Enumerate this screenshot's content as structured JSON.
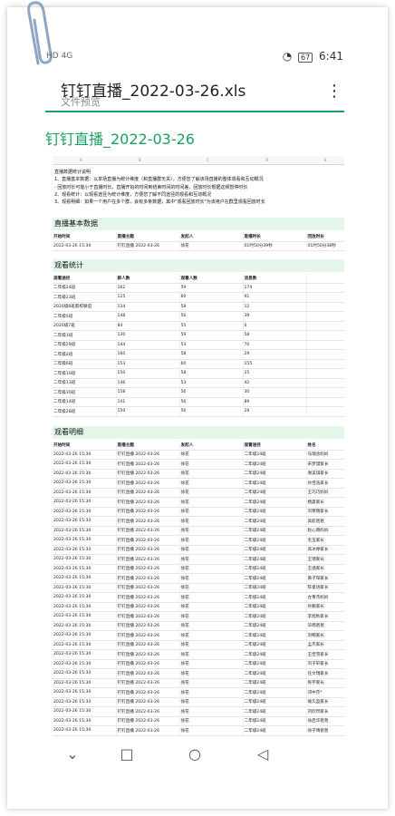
{
  "status": {
    "carrier": "HD 4G",
    "battery": "67",
    "time": "6:41"
  },
  "header": {
    "filename": "钉钉直播_2022-03-26.xls",
    "subtitle": "文件预览",
    "more": "⋮"
  },
  "sheet_title": "钉钉直播_2022-03-26",
  "col_letters": [
    "A",
    "B",
    "C",
    "D",
    "E"
  ],
  "notes": [
    "直播数据统计说明",
    "1、直播基本数据：以单场直播为统计维度（和直播群无关），方便您了解该场直播的整体观看和互动概况",
    "  - 回放时长可能小于直播时长，直播开始的时间到结束时间的时间差，回放时长根据这频暂停时长",
    "2、观看统计：以观看途径为统计维度，方便您了解不同途径的观看和互动概况",
    "3、观看明细：如果一个用户在多个群，会有多条数据，其中\"观看回放时长\"为该用户在群里观看回放时长"
  ],
  "section1": {
    "title": "直播基本数据",
    "headers": [
      "开始时间",
      "直播主题",
      "发起人",
      "直播时长",
      "回放时长"
    ],
    "rows": [
      [
        "2022-03-26 15:30",
        "钉钉直播 2022-03-26",
        "徐花",
        "01时50分39秒",
        "01时50分38秒"
      ]
    ]
  },
  "section2": {
    "title": "观看统计",
    "headers": [
      "观看途径",
      "群人数",
      "观看人数",
      "消息数"
    ],
    "rows": [
      [
        "二年级24班",
        "162",
        "59",
        "174"
      ],
      [
        "二年级23班",
        "125",
        "60",
        "91"
      ],
      [
        "2020级8班家校联谊",
        "134",
        "58",
        "12"
      ],
      [
        "二年级5班",
        "148",
        "56",
        "39"
      ],
      [
        "2020级7班",
        "84",
        "55",
        "6"
      ],
      [
        "二年级1班",
        "130",
        "59",
        "58"
      ],
      [
        "二年级29班",
        "144",
        "53",
        "70"
      ],
      [
        "二年级2班",
        "160",
        "58",
        "29"
      ],
      [
        "二年级6班",
        "153",
        "60",
        "155"
      ],
      [
        "二年级10班",
        "150",
        "58",
        "25"
      ],
      [
        "二年级13班",
        "146",
        "53",
        "42"
      ],
      [
        "二年级30班",
        "158",
        "56",
        "30"
      ],
      [
        "二年级14班",
        "141",
        "56",
        "89"
      ],
      [
        "二年级28班",
        "150",
        "56",
        "29"
      ]
    ]
  },
  "section3": {
    "title": "观看明细",
    "headers": [
      "开始时间",
      "直播主题",
      "发起人",
      "观看途径",
      "姓名"
    ],
    "names": [
      "马瑞含妈妈",
      "宋梦漫家长",
      "谢美琪家长",
      "孙佳浩家长",
      "王巧巧妈妈",
      "杨晨家长",
      "刘寒雨家长",
      "高航爸爸",
      "赵心雨妈妈",
      "毛玉家长",
      "高冰婷家长",
      "王瑞家长",
      "王涵家长",
      "黄子琛家长",
      "陈俊语家长",
      "左青杰妈妈",
      "孙鹏家长",
      "李旭秋家长",
      "毕雨爸爸",
      "刘畅家长",
      "孟杰家长",
      "王佳雪家长",
      "刘子轩家长",
      "任文瑞家长",
      "张宇家长",
      "邓中莎*",
      "瑜久盈家长",
      "刘欣然家长",
      "徐启华爸爸",
      "徐子晴爸爸"
    ],
    "row_start": "2022-03-26 15:30",
    "row_theme": "钉钉直播 2022-03-26",
    "row_host": "徐花",
    "row_channel": "二年级24班"
  }
}
